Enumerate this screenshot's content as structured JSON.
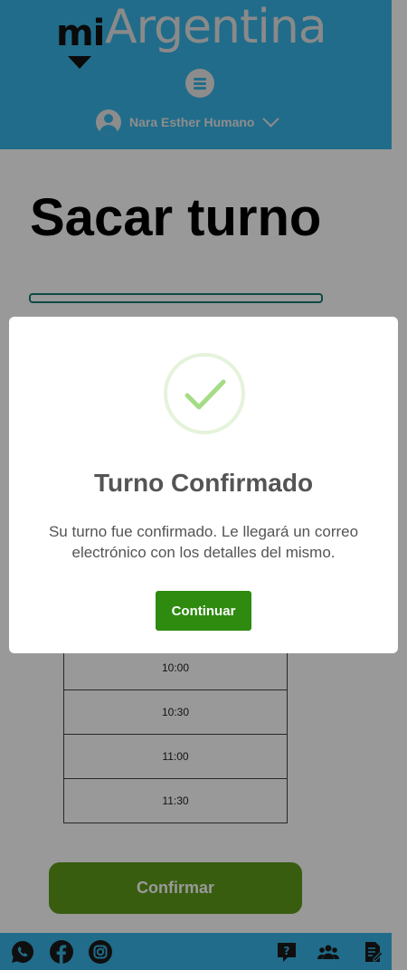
{
  "header": {
    "logo_mi": "mi",
    "logo_brand": "Argentina",
    "menu_icon": "menu-icon",
    "user_name": "Nara Esther Humano",
    "user_icon": "user-avatar-icon",
    "dropdown_icon": "chevron-down-icon"
  },
  "main": {
    "title": "Sacar turno",
    "time_slots": [
      "10:00",
      "10:30",
      "11:00",
      "11:30"
    ],
    "confirm_label": "Confirmar"
  },
  "footer": {
    "icons": [
      "whatsapp-icon",
      "facebook-icon",
      "instagram-icon",
      "help-icon",
      "community-icon",
      "document-edit-icon"
    ]
  },
  "modal": {
    "icon": "check-icon",
    "title": "Turno Confirmado",
    "message": "Su turno fue confirmado. Le llegará un correo electrónico con los detalles del mismo.",
    "continue_label": "Continuar"
  },
  "colors": {
    "header_blue": "#37b5e6",
    "progress_teal": "#1a7a72",
    "confirm_green": "#5e9c1a",
    "continue_green": "#2e8b10",
    "check_green": "#a5dc86"
  }
}
